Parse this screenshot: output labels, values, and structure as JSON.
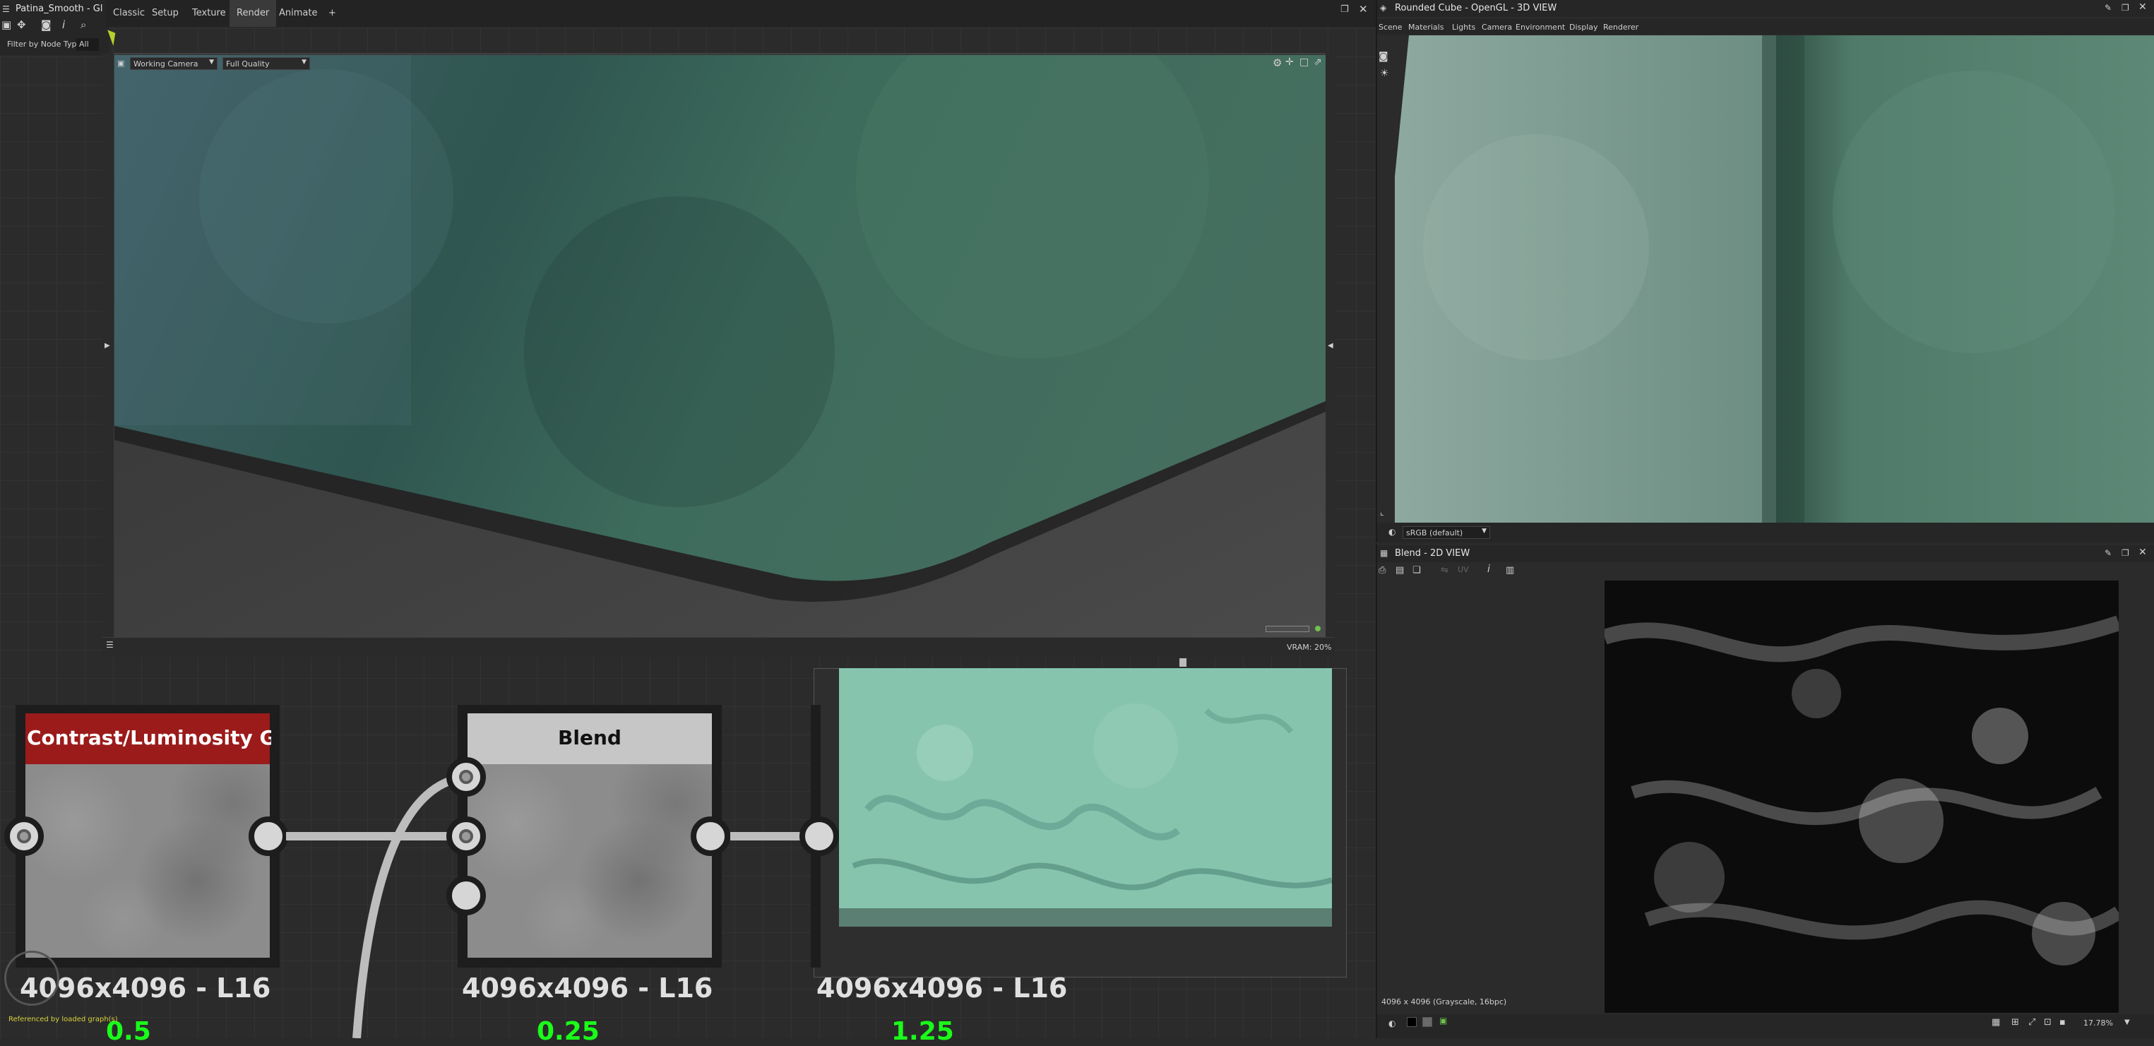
{
  "graph_panel": {
    "title": "Patina_Smooth - Gl",
    "filter_label": "Filter by Node Type",
    "filter_value": "All",
    "referenced_text": "Referenced by loaded graph(s)"
  },
  "top_menu": {
    "items": [
      "Classic",
      "Setup",
      "Texture",
      "Render",
      "Animate",
      "+"
    ]
  },
  "viewport": {
    "camera_select": "Working Camera",
    "quality_select": "Full Quality",
    "vram_text": "VRAM: 20%"
  },
  "nodes": [
    {
      "title": "Contrast/Luminosity G...",
      "resolution": "4096x4096 - L16",
      "value": "0.5"
    },
    {
      "title": "Blend",
      "resolution": "4096x4096 - L16",
      "value": "0.25"
    },
    {
      "title": "",
      "resolution": "4096x4096 - L16",
      "value": "1.25"
    }
  ],
  "view3d": {
    "title": "Rounded Cube - OpenGL - 3D VIEW",
    "menu": [
      "Scene",
      "Materials",
      "Lights",
      "Camera",
      "Environment",
      "Display",
      "Renderer"
    ],
    "colorspace": "sRGB (default)"
  },
  "view2d": {
    "title": "Blend - 2D VIEW",
    "info_text": "4096 x 4096 (Grayscale, 16bpc)",
    "zoom": "17.78%"
  },
  "colors": {
    "accent_red": "#9b1b1b",
    "value_green": "#1aff1a",
    "panel_bg": "#2a2a2a",
    "menu_bg": "#232323"
  }
}
